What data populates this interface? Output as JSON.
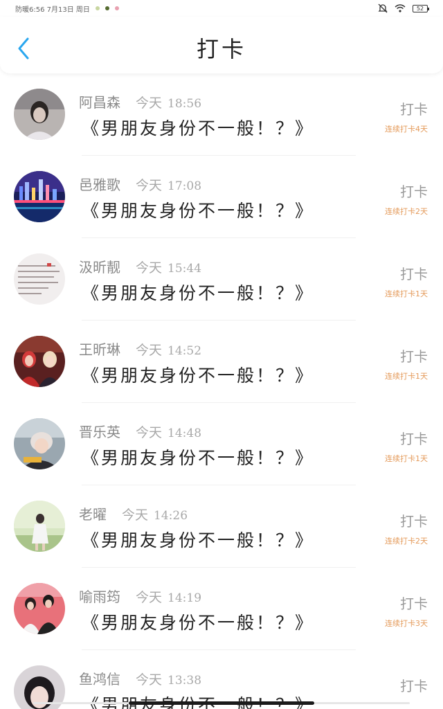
{
  "status_bar": {
    "left_text": "防暖6:56  7月13日  周日",
    "battery": "52"
  },
  "header": {
    "title": "打卡"
  },
  "colors": {
    "back_arrow": "#2aa7ef",
    "streak": "#e49a5a"
  },
  "items": [
    {
      "name": "阿昌森",
      "day": "今天",
      "time": "18:56",
      "title": "《男朋友身份不一般！？》",
      "action": "打卡",
      "streak": "连续打卡4天"
    },
    {
      "name": "邑雅歌",
      "day": "今天",
      "time": "17:08",
      "title": "《男朋友身份不一般！？》",
      "action": "打卡",
      "streak": "连续打卡2天"
    },
    {
      "name": "汲昕靓",
      "day": "今天",
      "time": "15:44",
      "title": "《男朋友身份不一般！？》",
      "action": "打卡",
      "streak": "连续打卡1天"
    },
    {
      "name": "王昕琳",
      "day": "今天",
      "time": "14:52",
      "title": "《男朋友身份不一般！？》",
      "action": "打卡",
      "streak": "连续打卡1天"
    },
    {
      "name": "晋乐英",
      "day": "今天",
      "time": "14:48",
      "title": "《男朋友身份不一般！？》",
      "action": "打卡",
      "streak": "连续打卡1天"
    },
    {
      "name": "老曜",
      "day": "今天",
      "time": "14:26",
      "title": "《男朋友身份不一般！？》",
      "action": "打卡",
      "streak": "连续打卡2天"
    },
    {
      "name": "喻雨筠",
      "day": "今天",
      "time": "14:19",
      "title": "《男朋友身份不一般！？》",
      "action": "打卡",
      "streak": "连续打卡3天"
    },
    {
      "name": "鱼鸿信",
      "day": "今天",
      "time": "13:38",
      "title": "《男朋友身份不一般！？》",
      "action": "打卡",
      "streak": ""
    }
  ]
}
